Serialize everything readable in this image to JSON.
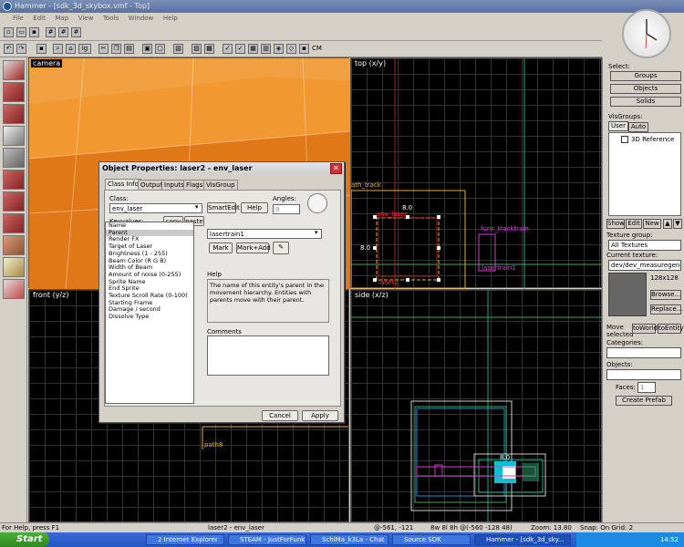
{
  "window": {
    "title": "Hammer - [sdk_3d_skybox.vmf - Top]"
  },
  "menu": [
    "File",
    "Edit",
    "Map",
    "View",
    "Tools",
    "Window",
    "Help"
  ],
  "toolbar": {
    "cm_label": "CM",
    "ig_label": "ig"
  },
  "viewports": {
    "camera": "camera",
    "top": "top (x/y)",
    "front": "front (y/z)",
    "side": "side (x/z)"
  },
  "top_view": {
    "path_track": "ath_track",
    "env_laser": "env_laser",
    "func_tracktrain": "func_tracktrain",
    "lasertrain1": "lasertrain1",
    "laser2": "laser2",
    "dim_top": "8.0",
    "dim_left": "8.0"
  },
  "front_view": {
    "path8": "path8"
  },
  "side_view": {
    "dim": "8.0"
  },
  "dialog": {
    "title": "Object Properties: laser2 - env_laser",
    "close": "✕",
    "tabs": [
      "Class Info",
      "Outputs",
      "Inputs",
      "Flags",
      "VisGroup"
    ],
    "class_label": "Class:",
    "class_value": "env_laser",
    "smartedit": "SmartEdit",
    "help_button": "Help",
    "angles_label": "Angles:",
    "angles_value": "0",
    "keyvalues_label": "Keyvalues:",
    "copy": "copy",
    "paste": "paste",
    "keyvalues": [
      "Name",
      "Parent",
      "Render FX",
      "Target of Laser",
      "Brightness (1 - 255)",
      "Beam Color (R G B)",
      "Width of Beam",
      "Amount of noise (0-255)",
      "Sprite Name",
      "End Sprite",
      "Texture Scroll Rate (0-100)",
      "Starting Frame",
      "Damage / second",
      "Dissolve Type"
    ],
    "value_field": "lasertrain1",
    "mark": "Mark",
    "mark_add": "Mark+Add",
    "help_label": "Help",
    "help_text": "The name of this entity's parent in the movement hierarchy. Entities with parents move with their parent.",
    "comments_label": "Comments",
    "cancel": "Cancel",
    "apply": "Apply"
  },
  "right_panel": {
    "select_label": "Select:",
    "groups": "Groups",
    "objects": "Objects",
    "solids": "Solids",
    "visgroups_label": "VisGroups:",
    "tab_user": "User",
    "tab_auto": "Auto",
    "visgroup_item": "3D Reference",
    "show": "Show",
    "edit": "Edit",
    "new": "New",
    "texture_group_label": "Texture group:",
    "texture_group": "All Textures",
    "current_texture_label": "Current texture:",
    "current_texture": "dev/dev_measuregene",
    "texture_size": "128x128",
    "browse": "Browse...",
    "replace": "Replace...",
    "move_selected": "Move selected",
    "to_world": "toWorld",
    "to_entity": "toEntity",
    "categories_label": "Categories:",
    "objects_label": "Objects:",
    "faces_label": "Faces:",
    "faces_value": "1",
    "create_prefab": "Create Prefab"
  },
  "status": {
    "help": "For Help, press F1",
    "selection": "laser2 - env_laser",
    "coords": "@-561, -121",
    "size": "8w 8l 8h @(-560 -128 48)",
    "zoom": "Zoom: 13.80",
    "snap": "Snap: On Grid: 2"
  },
  "taskbar": {
    "start": "Start",
    "tasks": [
      "2 Internet Explorer",
      "STEAM - JustForFunk...",
      "SchiMa_k3La - Chat",
      "Source SDK",
      "Hammer - [sdk_3d_sky..."
    ],
    "clock": "14:52"
  },
  "colors": {
    "camera_orange": "#f08c1c",
    "entity_yellow": "#e0b030",
    "selection_red": "#ff3030",
    "track_green": "#20c060",
    "magenta": "#d040d0"
  }
}
